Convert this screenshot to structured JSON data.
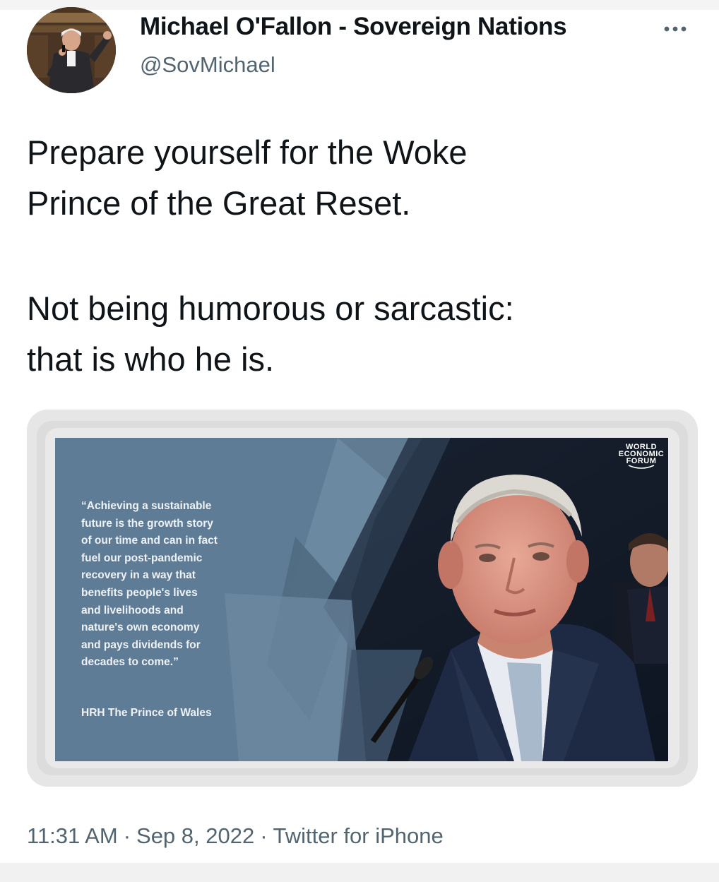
{
  "author": {
    "display_name": "Michael O'Fallon - Sovereign Nations",
    "handle": "@SovMichael"
  },
  "tweet": {
    "line1": "Prepare yourself for the Woke",
    "line2": "Prince of the Great Reset.",
    "line3": "Not being humorous or sarcastic:",
    "line4": "that is who he is."
  },
  "media": {
    "quote": "“Achieving a sustainable\nfuture is the growth story\nof our time and can in fact\nfuel our post-pandemic\nrecovery in a way that\nbenefits people's lives\nand livelihoods and\nnature's own economy\nand pays dividends for\ndecades to come.”",
    "attribution": "HRH The Prince of Wales",
    "logo_line1": "WORLD",
    "logo_line2": "ECONOMIC",
    "logo_line3": "FORUM"
  },
  "meta": {
    "time": "11:31 AM",
    "date": "Sep 8, 2022",
    "source": "Twitter for iPhone",
    "separator": "·"
  },
  "icons": {
    "more": "more-horizontal-icon"
  },
  "colors": {
    "text": "#0f1419",
    "secondary": "#536471",
    "quote_panel": "#5e7c95"
  }
}
